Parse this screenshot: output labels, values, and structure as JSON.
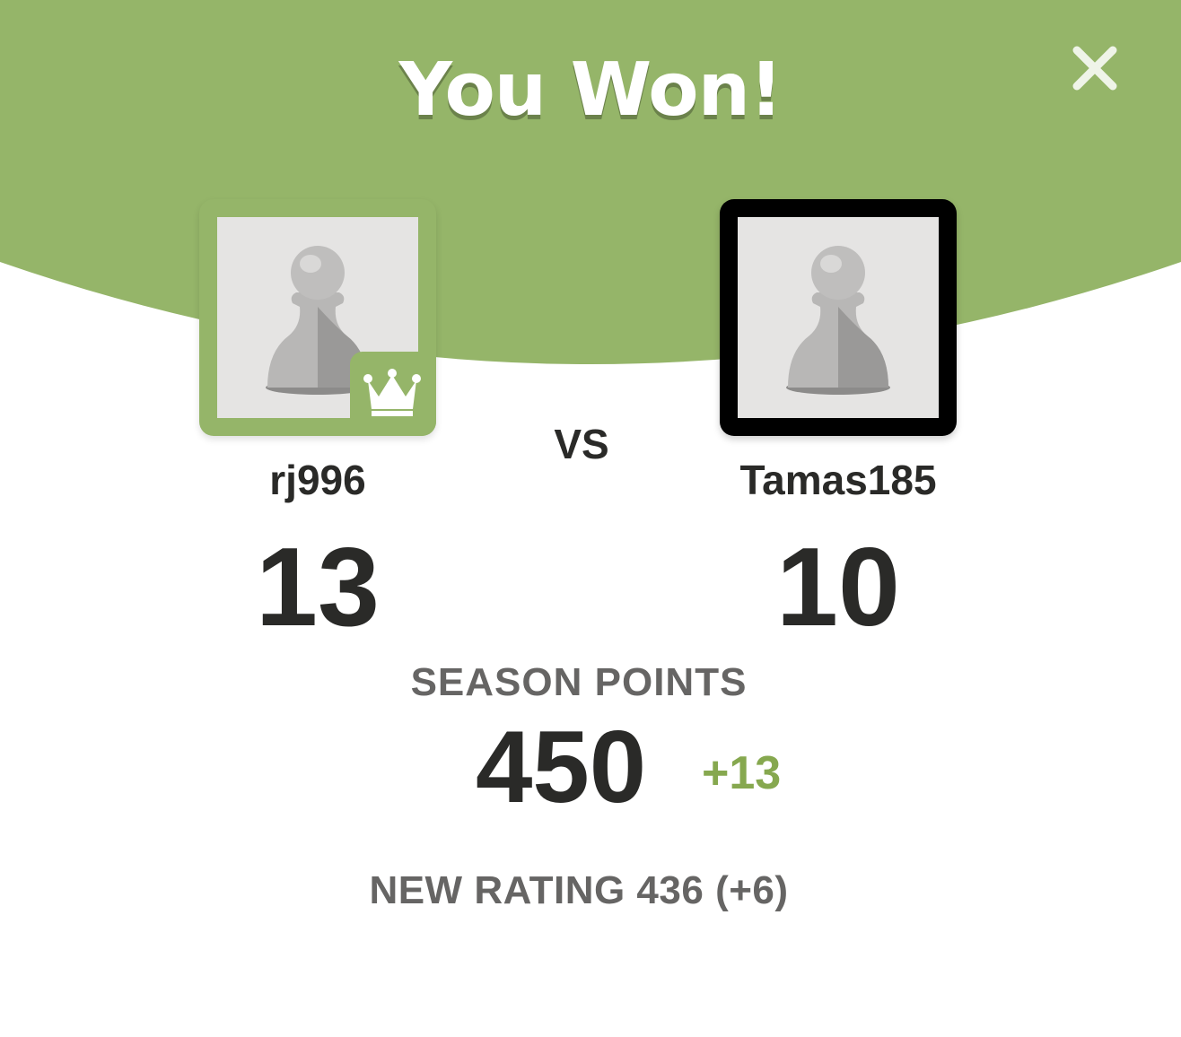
{
  "title": "You Won!",
  "colors": {
    "header_green": "#95b569",
    "delta_green": "#86a84f",
    "text_dark": "#2a2a28",
    "text_gray": "#666564"
  },
  "icons": {
    "close": "close-icon",
    "avatar_placeholder": "pawn-icon",
    "winner_badge": "crown-icon"
  },
  "players": {
    "left": {
      "username": "rj996",
      "score": "13"
    },
    "right": {
      "username": "Tamas185",
      "score": "10"
    }
  },
  "vs_label": "VS",
  "season": {
    "label": "SEASON POINTS",
    "value": "450",
    "delta": "+13"
  },
  "rating_text": "NEW RATING 436 (+6)"
}
